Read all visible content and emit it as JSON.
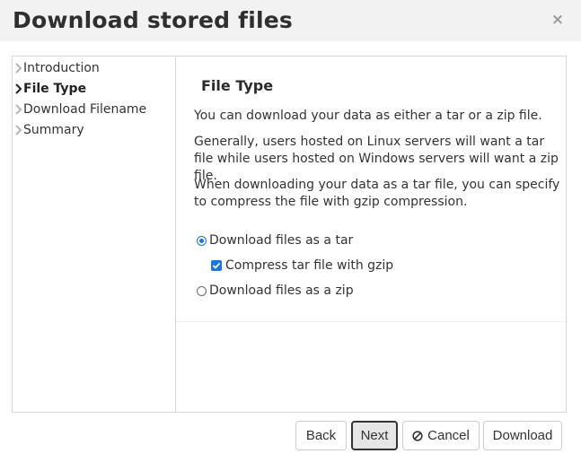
{
  "dialog": {
    "title": "Download stored files",
    "close_label": "×"
  },
  "nav": {
    "items": [
      {
        "label": "Introduction",
        "active": false
      },
      {
        "label": "File Type",
        "active": true
      },
      {
        "label": "Download Filename",
        "active": false
      },
      {
        "label": "Summary",
        "active": false
      }
    ]
  },
  "content": {
    "heading": "File Type",
    "paragraphs": [
      "You can download your data as either a tar or a zip file.",
      "Generally, users hosted on Linux servers will want a tar file while users hosted on Windows servers will want a zip file.",
      "When downloading your data as a tar file, you can specify to compress the file with gzip compression."
    ],
    "options": {
      "tar_label": "Download files as a tar",
      "tar_selected": true,
      "gzip_label": "Compress tar file with gzip",
      "gzip_checked": true,
      "zip_label": "Download files as a zip",
      "zip_selected": false
    }
  },
  "buttons": {
    "back": "Back",
    "next": "Next",
    "cancel": "Cancel",
    "download": "Download"
  },
  "colors": {
    "accent": "#1a73e8",
    "titlebar_bg": "#f2f2f2",
    "border": "#d8d8d8"
  },
  "icons": {
    "nav_chevron": "chevron-right-icon",
    "close": "close-icon",
    "cancel": "ban-icon"
  }
}
